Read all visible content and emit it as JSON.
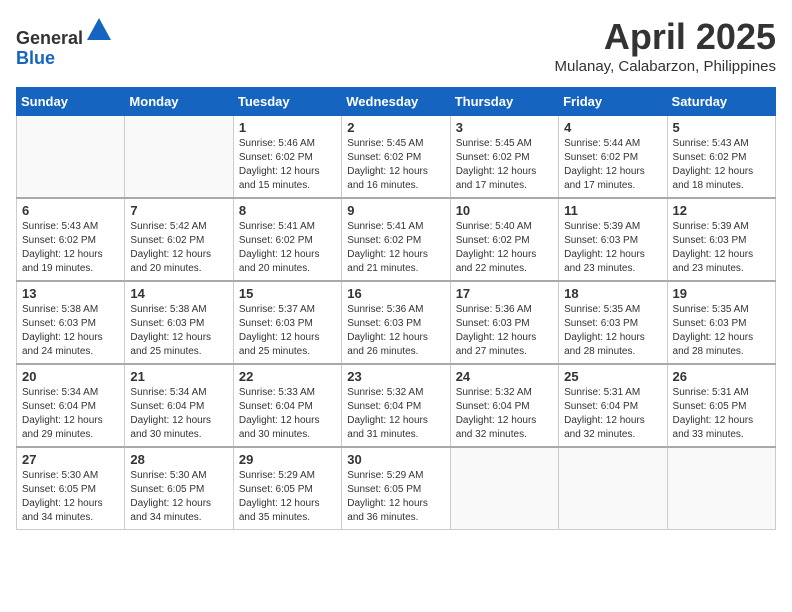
{
  "header": {
    "logo_line1": "General",
    "logo_line2": "Blue",
    "month": "April 2025",
    "location": "Mulanay, Calabarzon, Philippines"
  },
  "weekdays": [
    "Sunday",
    "Monday",
    "Tuesday",
    "Wednesday",
    "Thursday",
    "Friday",
    "Saturday"
  ],
  "weeks": [
    [
      {
        "day": "",
        "sunrise": "",
        "sunset": "",
        "daylight": ""
      },
      {
        "day": "",
        "sunrise": "",
        "sunset": "",
        "daylight": ""
      },
      {
        "day": "1",
        "sunrise": "Sunrise: 5:46 AM",
        "sunset": "Sunset: 6:02 PM",
        "daylight": "Daylight: 12 hours and 15 minutes."
      },
      {
        "day": "2",
        "sunrise": "Sunrise: 5:45 AM",
        "sunset": "Sunset: 6:02 PM",
        "daylight": "Daylight: 12 hours and 16 minutes."
      },
      {
        "day": "3",
        "sunrise": "Sunrise: 5:45 AM",
        "sunset": "Sunset: 6:02 PM",
        "daylight": "Daylight: 12 hours and 17 minutes."
      },
      {
        "day": "4",
        "sunrise": "Sunrise: 5:44 AM",
        "sunset": "Sunset: 6:02 PM",
        "daylight": "Daylight: 12 hours and 17 minutes."
      },
      {
        "day": "5",
        "sunrise": "Sunrise: 5:43 AM",
        "sunset": "Sunset: 6:02 PM",
        "daylight": "Daylight: 12 hours and 18 minutes."
      }
    ],
    [
      {
        "day": "6",
        "sunrise": "Sunrise: 5:43 AM",
        "sunset": "Sunset: 6:02 PM",
        "daylight": "Daylight: 12 hours and 19 minutes."
      },
      {
        "day": "7",
        "sunrise": "Sunrise: 5:42 AM",
        "sunset": "Sunset: 6:02 PM",
        "daylight": "Daylight: 12 hours and 20 minutes."
      },
      {
        "day": "8",
        "sunrise": "Sunrise: 5:41 AM",
        "sunset": "Sunset: 6:02 PM",
        "daylight": "Daylight: 12 hours and 20 minutes."
      },
      {
        "day": "9",
        "sunrise": "Sunrise: 5:41 AM",
        "sunset": "Sunset: 6:02 PM",
        "daylight": "Daylight: 12 hours and 21 minutes."
      },
      {
        "day": "10",
        "sunrise": "Sunrise: 5:40 AM",
        "sunset": "Sunset: 6:02 PM",
        "daylight": "Daylight: 12 hours and 22 minutes."
      },
      {
        "day": "11",
        "sunrise": "Sunrise: 5:39 AM",
        "sunset": "Sunset: 6:03 PM",
        "daylight": "Daylight: 12 hours and 23 minutes."
      },
      {
        "day": "12",
        "sunrise": "Sunrise: 5:39 AM",
        "sunset": "Sunset: 6:03 PM",
        "daylight": "Daylight: 12 hours and 23 minutes."
      }
    ],
    [
      {
        "day": "13",
        "sunrise": "Sunrise: 5:38 AM",
        "sunset": "Sunset: 6:03 PM",
        "daylight": "Daylight: 12 hours and 24 minutes."
      },
      {
        "day": "14",
        "sunrise": "Sunrise: 5:38 AM",
        "sunset": "Sunset: 6:03 PM",
        "daylight": "Daylight: 12 hours and 25 minutes."
      },
      {
        "day": "15",
        "sunrise": "Sunrise: 5:37 AM",
        "sunset": "Sunset: 6:03 PM",
        "daylight": "Daylight: 12 hours and 25 minutes."
      },
      {
        "day": "16",
        "sunrise": "Sunrise: 5:36 AM",
        "sunset": "Sunset: 6:03 PM",
        "daylight": "Daylight: 12 hours and 26 minutes."
      },
      {
        "day": "17",
        "sunrise": "Sunrise: 5:36 AM",
        "sunset": "Sunset: 6:03 PM",
        "daylight": "Daylight: 12 hours and 27 minutes."
      },
      {
        "day": "18",
        "sunrise": "Sunrise: 5:35 AM",
        "sunset": "Sunset: 6:03 PM",
        "daylight": "Daylight: 12 hours and 28 minutes."
      },
      {
        "day": "19",
        "sunrise": "Sunrise: 5:35 AM",
        "sunset": "Sunset: 6:03 PM",
        "daylight": "Daylight: 12 hours and 28 minutes."
      }
    ],
    [
      {
        "day": "20",
        "sunrise": "Sunrise: 5:34 AM",
        "sunset": "Sunset: 6:04 PM",
        "daylight": "Daylight: 12 hours and 29 minutes."
      },
      {
        "day": "21",
        "sunrise": "Sunrise: 5:34 AM",
        "sunset": "Sunset: 6:04 PM",
        "daylight": "Daylight: 12 hours and 30 minutes."
      },
      {
        "day": "22",
        "sunrise": "Sunrise: 5:33 AM",
        "sunset": "Sunset: 6:04 PM",
        "daylight": "Daylight: 12 hours and 30 minutes."
      },
      {
        "day": "23",
        "sunrise": "Sunrise: 5:32 AM",
        "sunset": "Sunset: 6:04 PM",
        "daylight": "Daylight: 12 hours and 31 minutes."
      },
      {
        "day": "24",
        "sunrise": "Sunrise: 5:32 AM",
        "sunset": "Sunset: 6:04 PM",
        "daylight": "Daylight: 12 hours and 32 minutes."
      },
      {
        "day": "25",
        "sunrise": "Sunrise: 5:31 AM",
        "sunset": "Sunset: 6:04 PM",
        "daylight": "Daylight: 12 hours and 32 minutes."
      },
      {
        "day": "26",
        "sunrise": "Sunrise: 5:31 AM",
        "sunset": "Sunset: 6:05 PM",
        "daylight": "Daylight: 12 hours and 33 minutes."
      }
    ],
    [
      {
        "day": "27",
        "sunrise": "Sunrise: 5:30 AM",
        "sunset": "Sunset: 6:05 PM",
        "daylight": "Daylight: 12 hours and 34 minutes."
      },
      {
        "day": "28",
        "sunrise": "Sunrise: 5:30 AM",
        "sunset": "Sunset: 6:05 PM",
        "daylight": "Daylight: 12 hours and 34 minutes."
      },
      {
        "day": "29",
        "sunrise": "Sunrise: 5:29 AM",
        "sunset": "Sunset: 6:05 PM",
        "daylight": "Daylight: 12 hours and 35 minutes."
      },
      {
        "day": "30",
        "sunrise": "Sunrise: 5:29 AM",
        "sunset": "Sunset: 6:05 PM",
        "daylight": "Daylight: 12 hours and 36 minutes."
      },
      {
        "day": "",
        "sunrise": "",
        "sunset": "",
        "daylight": ""
      },
      {
        "day": "",
        "sunrise": "",
        "sunset": "",
        "daylight": ""
      },
      {
        "day": "",
        "sunrise": "",
        "sunset": "",
        "daylight": ""
      }
    ]
  ]
}
